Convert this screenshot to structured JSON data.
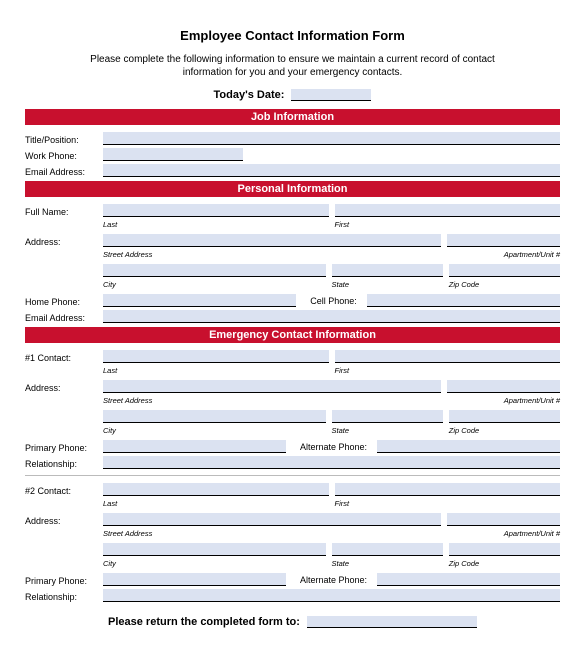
{
  "title": "Employee Contact Information Form",
  "instructions": "Please complete the following information to ensure we maintain a current record of contact information for you and your emergency contacts.",
  "todays_date_label": "Today's Date:",
  "sections": {
    "job": {
      "header": "Job Information",
      "title_label": "Title/Position:",
      "work_phone_label": "Work Phone:",
      "email_label": "Email Address:"
    },
    "personal": {
      "header": "Personal Information",
      "fullname_label": "Full Name:",
      "sub_last": "Last",
      "sub_first": "First",
      "address_label": "Address:",
      "sub_street": "Street Address",
      "sub_apt": "Apartment/Unit #",
      "sub_city": "City",
      "sub_state": "State",
      "sub_zip": "Zip Code",
      "home_phone_label": "Home Phone:",
      "cell_phone_label": "Cell Phone:",
      "email_label": "Email Address:"
    },
    "emergency": {
      "header": "Emergency Contact Information",
      "contact1_label": "#1 Contact:",
      "contact2_label": "#2 Contact:",
      "sub_last": "Last",
      "sub_first": "First",
      "address_label": "Address:",
      "sub_street": "Street Address",
      "sub_apt": "Apartment/Unit #",
      "sub_city": "City",
      "sub_state": "State",
      "sub_zip": "Zip Code",
      "primary_phone_label": "Primary Phone:",
      "alternate_phone_label": "Alternate Phone:",
      "relationship_label": "Relationship:"
    }
  },
  "return_label": "Please return the completed form to:"
}
